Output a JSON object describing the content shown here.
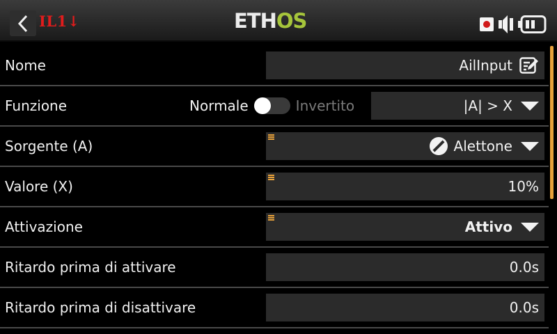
{
  "header": {
    "mode_label": "IL1↓",
    "brand_main": "ETH",
    "brand_accent": "OS"
  },
  "icons": {
    "back": "chevron-left-icon",
    "record": "record-icon",
    "speaker": "speaker-icon",
    "battery": "battery-icon",
    "edit": "edit-icon",
    "source": "source-slash-icon",
    "caret": "caret-down-icon",
    "options": "options-lines-icon"
  },
  "colors": {
    "accent_orange": "#e8a13a",
    "brand_green": "#a6c53b",
    "mode_red": "#e11c1c",
    "record_red": "#d01818"
  },
  "form": {
    "name": {
      "label": "Nome",
      "value": "AilInput"
    },
    "function": {
      "label": "Funzione",
      "toggle_off": "Normale",
      "toggle_on": "Invertito",
      "toggle_state": "off",
      "value": "|A| > X"
    },
    "source": {
      "label": "Sorgente (A)",
      "value": "Alettone"
    },
    "value_x": {
      "label": "Valore (X)",
      "value": "10%"
    },
    "activation": {
      "label": "Attivazione",
      "value": "Attivo"
    },
    "delay_on": {
      "label": "Ritardo prima di attivare",
      "value": "0.0s"
    },
    "delay_off": {
      "label": "Ritardo prima di disattivare",
      "value": "0.0s"
    }
  }
}
